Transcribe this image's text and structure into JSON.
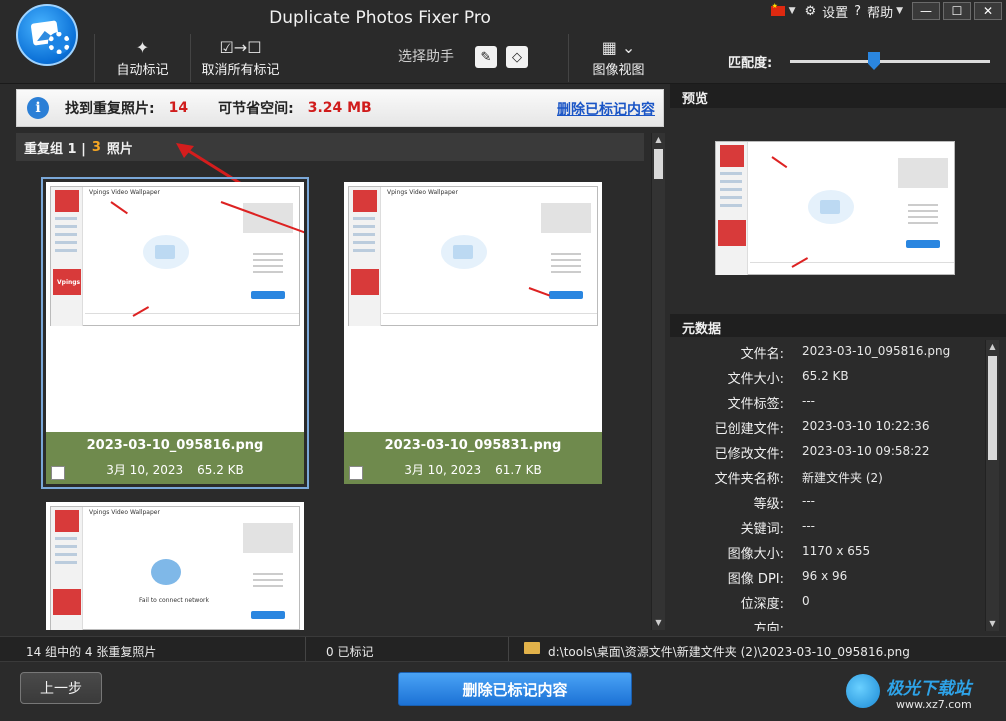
{
  "window": {
    "title": "Duplicate Photos Fixer Pro",
    "settings_label": "设置",
    "help_label": "帮助",
    "minimize_glyph": "—",
    "maximize_glyph": "☐",
    "close_glyph": "✕"
  },
  "toolbar": {
    "auto_mark_label": "自动标记",
    "unmark_all_label": "取消所有标记",
    "assistant_label": "选择助手",
    "image_view_label": "图像视图",
    "match_label": "匹配度:",
    "match_level": 0.42
  },
  "info_bar": {
    "found_label": "找到重复照片:",
    "found_value": "14",
    "save_label": "可节省空间:",
    "save_value": "3.24 MB",
    "delete_link": "删除已标记内容"
  },
  "group": {
    "prefix": "重复组 1 |",
    "count": "3",
    "suffix": "照片"
  },
  "cards": [
    {
      "file_name": "2023-03-10_095816.png",
      "date": "3月 10, 2023",
      "size": "65.2 KB",
      "checked": false,
      "selected": true
    },
    {
      "file_name": "2023-03-10_095831.png",
      "date": "3月 10, 2023",
      "size": "61.7 KB",
      "checked": false,
      "selected": false
    },
    {
      "thumb_text": "Fail to connect network"
    }
  ],
  "thumb_texts": {
    "app_name": "Vpings Video Wallpaper",
    "brand": "Vpings",
    "button": "Set as Wallpaper"
  },
  "preview": {
    "header": "预览"
  },
  "metadata": {
    "header": "元数据",
    "rows": [
      {
        "key": "文件名:",
        "value": "2023-03-10_095816.png"
      },
      {
        "key": "文件大小:",
        "value": "65.2 KB"
      },
      {
        "key": "文件标签:",
        "value": "---"
      },
      {
        "key": "已创建文件:",
        "value": "2023-03-10 10:22:36"
      },
      {
        "key": "已修改文件:",
        "value": "2023-03-10 09:58:22"
      },
      {
        "key": "文件夹名称:",
        "value": "新建文件夹 (2)"
      },
      {
        "key": "等级:",
        "value": "---"
      },
      {
        "key": "关键词:",
        "value": "---"
      },
      {
        "key": "图像大小:",
        "value": "1170 x 655"
      },
      {
        "key": "图像 DPI:",
        "value": "96 x 96"
      },
      {
        "key": "位深度:",
        "value": "0"
      },
      {
        "key": "方向:",
        "value": ""
      }
    ]
  },
  "status": {
    "groups_text": "14 组中的 4 张重复照片",
    "marked_text": "0 已标记",
    "path_text": "d:\\tools\\桌面\\资源文件\\新建文件夹 (2)\\2023-03-10_095816.png"
  },
  "footer": {
    "back_label": "上一步",
    "delete_label": "删除已标记内容",
    "watermark_text": "极光下载站",
    "watermark_sub": "www.xz7.com"
  },
  "colors": {
    "accent": "#1c72d6",
    "card_meta": "#6f8a4d",
    "highlight": "#d01c1c",
    "group_count": "#f5a623"
  }
}
